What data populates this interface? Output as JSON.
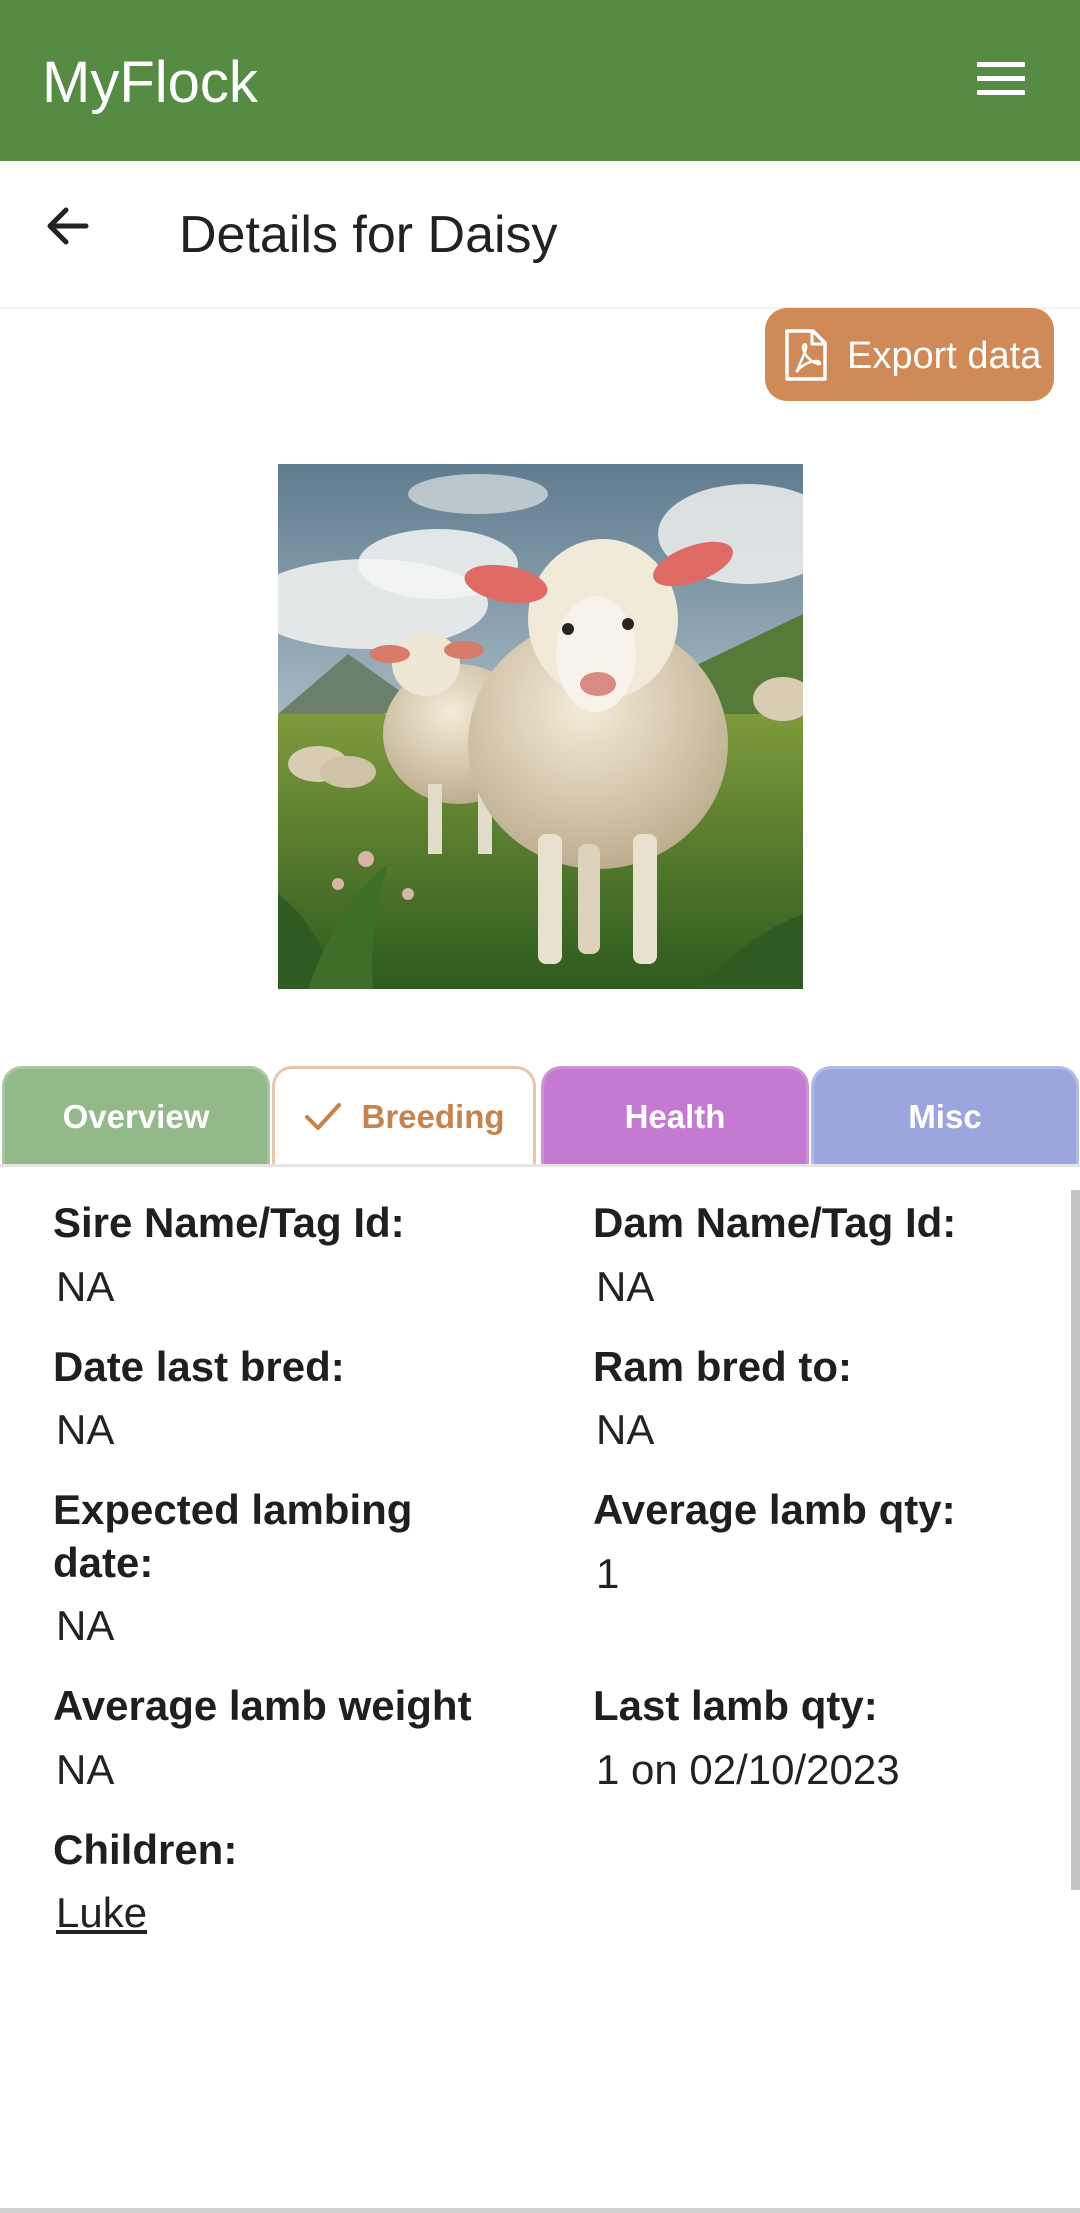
{
  "app": {
    "title": "MyFlock"
  },
  "header": {
    "title": "Details for Daisy"
  },
  "actions": {
    "export_label": "Export data"
  },
  "tabs": [
    {
      "label": "Overview",
      "selected": false
    },
    {
      "label": "Breeding",
      "selected": true
    },
    {
      "label": "Health",
      "selected": false
    },
    {
      "label": "Misc",
      "selected": false
    }
  ],
  "breeding": {
    "sire": {
      "label": "Sire Name/Tag Id:",
      "value": "NA"
    },
    "dam": {
      "label": "Dam Name/Tag Id:",
      "value": "NA"
    },
    "date_last_bred": {
      "label": "Date last bred:",
      "value": "NA"
    },
    "ram_bred_to": {
      "label": "Ram bred to:",
      "value": "NA"
    },
    "expected_lambing": {
      "label_line1": "Expected lambing",
      "label_line2": "date:",
      "value": "NA"
    },
    "avg_lamb_qty": {
      "label": "Average lamb qty:",
      "value": "1"
    },
    "avg_lamb_weight": {
      "label": "Average lamb weight",
      "value": "NA"
    },
    "last_lamb_qty": {
      "label": "Last lamb qty:",
      "value": "1 on 02/10/2023"
    },
    "children": {
      "label": "Children:",
      "items": [
        "Luke"
      ]
    }
  },
  "colors": {
    "topbar": "#558b42",
    "export_button": "#cf8a58",
    "tab_overview": "#93b98a",
    "tab_breeding_text": "#c4834f",
    "tab_health": "#c47ad1",
    "tab_misc": "#9aa6dd"
  },
  "icons": {
    "menu": "hamburger-icon",
    "back": "arrow-left-icon",
    "export": "pdf-file-icon",
    "selected_tab": "checkmark-icon"
  }
}
